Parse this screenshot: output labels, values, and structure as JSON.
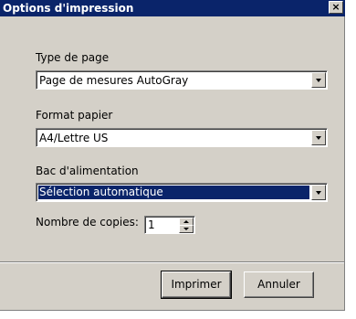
{
  "dialog": {
    "title": "Options d'impression",
    "close_label": "×"
  },
  "page_type": {
    "label": "Type de page",
    "value": "Page de mesures AutoGray"
  },
  "paper_format": {
    "label": "Format papier",
    "value": "A4/Lettre US"
  },
  "paper_tray": {
    "label": "Bac d'alimentation",
    "value": "Sélection automatique"
  },
  "copies": {
    "label": "Nombre de copies:",
    "value": "1"
  },
  "buttons": {
    "print": "Imprimer",
    "cancel": "Annuler"
  },
  "colors": {
    "title_bar": "#0a246a",
    "selection": "#0a246a",
    "face": "#d4d0c8"
  }
}
